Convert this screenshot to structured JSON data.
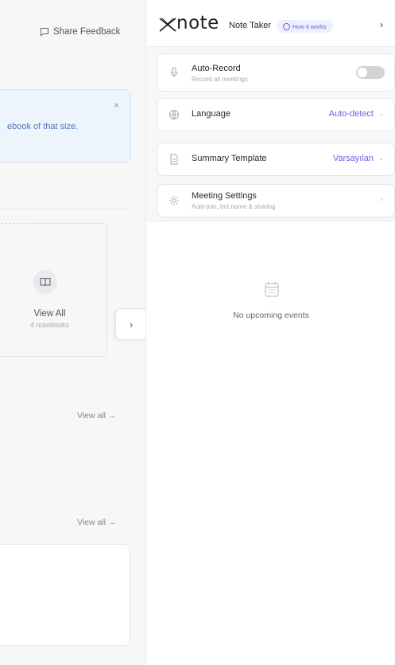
{
  "left": {
    "share_feedback": "Share Feedback",
    "banner_text": "ebook of that size.",
    "banner_close": "×",
    "view_all_card": {
      "title": "View All",
      "subtitle": "4 notebooks"
    },
    "view_all_link_1": "View all →",
    "view_all_link_2": "View all →",
    "panel_toggle": "›"
  },
  "panel": {
    "logo": "note",
    "note_taker": "Note Taker",
    "how_it_works": "How it works",
    "header_chevron": "›",
    "settings": {
      "auto_record": {
        "title": "Auto-Record",
        "subtitle": "Record all meetings",
        "enabled": false
      },
      "language": {
        "title": "Language",
        "value": "Auto-detect",
        "chevron": "⌄"
      },
      "summary_template": {
        "title": "Summary Template",
        "value": "Varsayılan",
        "chevron": "⌄"
      },
      "meeting_settings": {
        "title": "Meeting Settings",
        "subtitle": "Auto-join, bot name & sharing",
        "arrow": "›"
      }
    },
    "empty_state": "No upcoming events"
  }
}
